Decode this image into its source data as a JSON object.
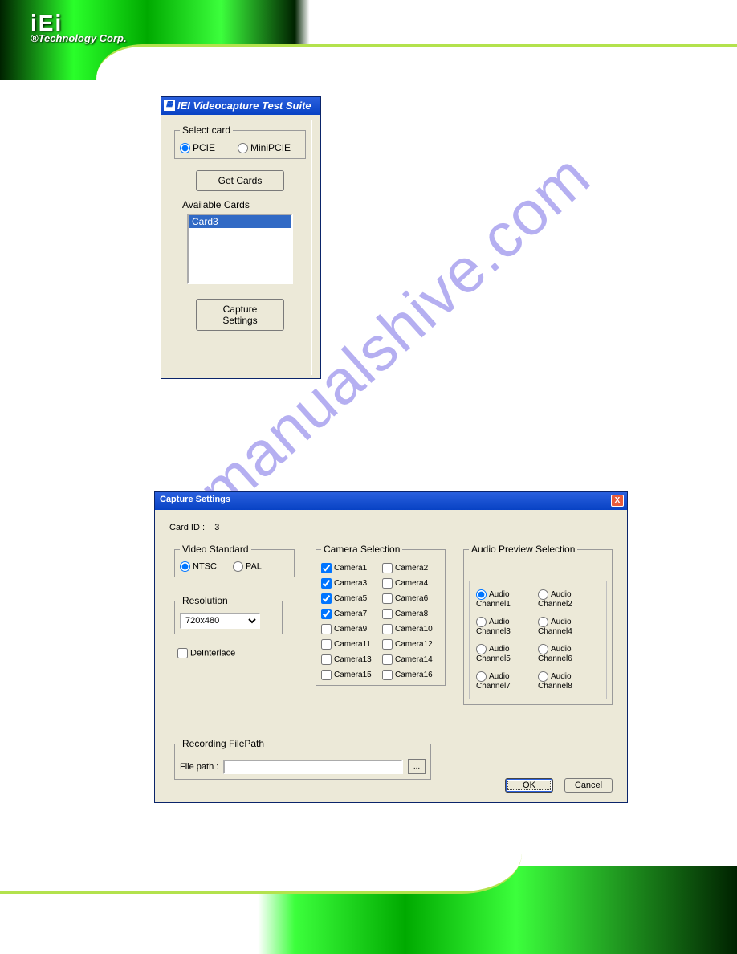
{
  "header": {
    "logo_top": "iEi",
    "logo_sub": "®Technology Corp."
  },
  "watermark": "manualshive.com",
  "dlg1": {
    "title": "IEI Videocapture Test Suite",
    "select_card_legend": "Select card",
    "radio_pcie": "PCIE",
    "radio_minipcie": "MiniPCIE",
    "selected_card_type": "PCIE",
    "get_cards_btn": "Get Cards",
    "available_cards_label": "Available Cards",
    "available_cards": [
      "Card3"
    ],
    "capture_settings_btn": "Capture Settings"
  },
  "dlg2": {
    "title": "Capture Settings",
    "card_id_label": "Card ID :",
    "card_id_value": "3",
    "video_standard_legend": "Video Standard",
    "radio_ntsc": "NTSC",
    "radio_pal": "PAL",
    "video_standard_selected": "NTSC",
    "resolution_legend": "Resolution",
    "resolution_value": "720x480",
    "deinterlace_label": "DeInterlace",
    "camera_legend": "Camera Selection",
    "cameras": [
      {
        "n": 1,
        "label": "Camera1",
        "checked": true
      },
      {
        "n": 2,
        "label": "Camera2",
        "checked": false
      },
      {
        "n": 3,
        "label": "Camera3",
        "checked": true
      },
      {
        "n": 4,
        "label": "Camera4",
        "checked": false
      },
      {
        "n": 5,
        "label": "Camera5",
        "checked": true
      },
      {
        "n": 6,
        "label": "Camera6",
        "checked": false
      },
      {
        "n": 7,
        "label": "Camera7",
        "checked": true
      },
      {
        "n": 8,
        "label": "Camera8",
        "checked": false
      },
      {
        "n": 9,
        "label": "Camera9",
        "checked": false
      },
      {
        "n": 10,
        "label": "Camera10",
        "checked": false
      },
      {
        "n": 11,
        "label": "Camera11",
        "checked": false
      },
      {
        "n": 12,
        "label": "Camera12",
        "checked": false
      },
      {
        "n": 13,
        "label": "Camera13",
        "checked": false
      },
      {
        "n": 14,
        "label": "Camera14",
        "checked": false
      },
      {
        "n": 15,
        "label": "Camera15",
        "checked": false
      },
      {
        "n": 16,
        "label": "Camera16",
        "checked": false
      }
    ],
    "audio_legend": "Audio Preview Selection",
    "audio_channels": [
      {
        "label": "Audio Channel1",
        "selected": true
      },
      {
        "label": "Audio Channel2",
        "selected": false
      },
      {
        "label": "Audio Channel3",
        "selected": false
      },
      {
        "label": "Audio Channel4",
        "selected": false
      },
      {
        "label": "Audio Channel5",
        "selected": false
      },
      {
        "label": "Audio Channel6",
        "selected": false
      },
      {
        "label": "Audio Channel7",
        "selected": false
      },
      {
        "label": "Audio Channel8",
        "selected": false
      }
    ],
    "recording_legend": "Recording FilePath",
    "filepath_label": "File path :",
    "filepath_value": "",
    "browse_btn": "...",
    "ok_btn": "OK",
    "cancel_btn": "Cancel"
  }
}
